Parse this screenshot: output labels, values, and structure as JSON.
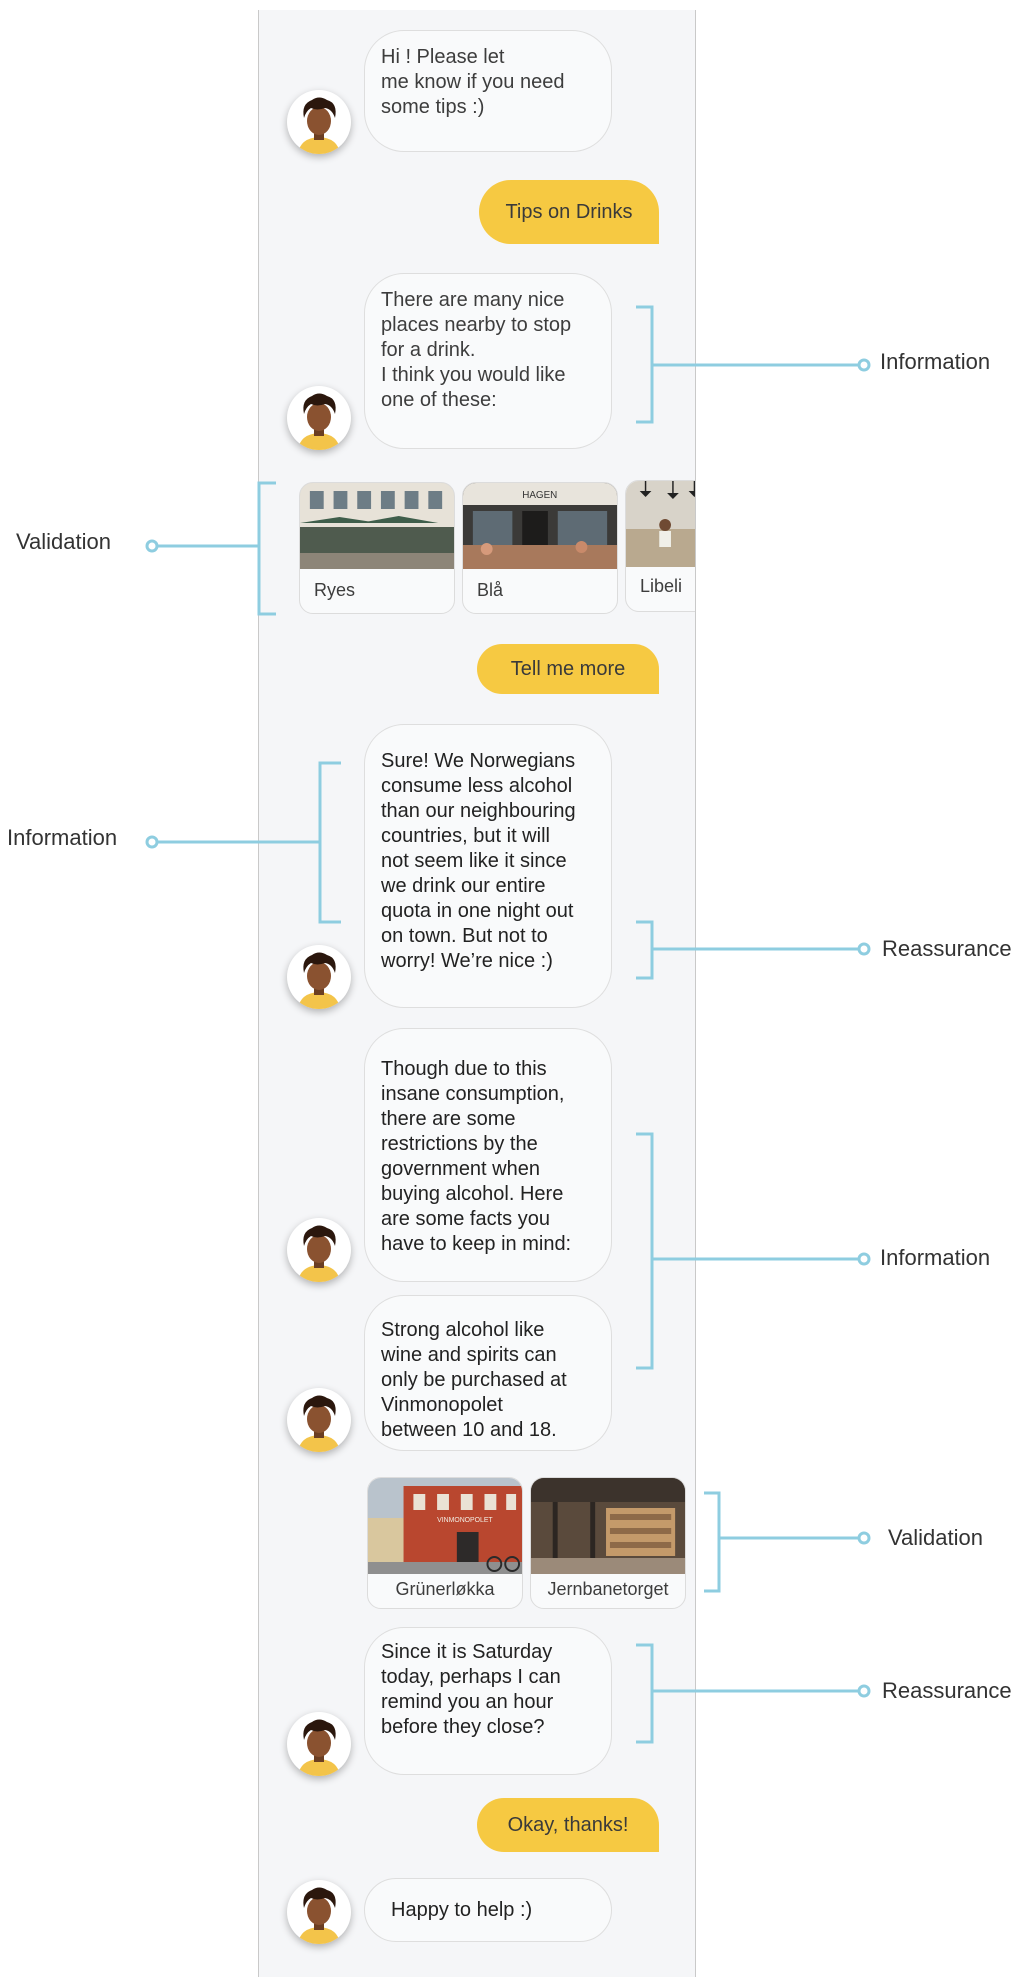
{
  "conversation": {
    "bot_greeting": [
      "Hi ! Please let",
      "me know if you need",
      "some tips :)"
    ],
    "user_tips": "Tips on Drinks",
    "bot_places": [
      "There are many nice",
      "places nearby to stop",
      "for a drink.",
      "I think you would like",
      "one of these:"
    ],
    "places": [
      {
        "name": "Ryes"
      },
      {
        "name": "Blå",
        "sign_text": "HAGEN"
      },
      {
        "name": "Libeli"
      }
    ],
    "user_more": "Tell me more",
    "bot_norwegians": [
      "Sure! We Norwegians",
      "consume less alcohol",
      "than our neighbouring",
      "countries, but it will",
      "not seem like it since",
      "we drink our entire",
      "quota in one night out",
      "on town. But not to",
      "worry! We’re nice :)"
    ],
    "bot_restrictions": [
      "Though due to this",
      "insane consumption,",
      "there are some",
      "restrictions by the",
      "government when",
      "buying alcohol. Here",
      "are some facts you",
      "have to keep in mind:"
    ],
    "bot_strong": [
      "Strong alcohol like",
      "wine and spirits can",
      "only be purchased at",
      "Vinmonopolet",
      "between 10 and 18."
    ],
    "stores": [
      {
        "name": "Grünerløkka",
        "sign_text": "VINMONOPOLET"
      },
      {
        "name": "Jernbanetorget"
      }
    ],
    "bot_saturday": [
      "Since it is Saturday",
      "today, perhaps I can",
      "remind you an hour",
      "before they close?"
    ],
    "user_thanks": "Okay, thanks!",
    "bot_happy": "Happy to help :)"
  },
  "annotations": {
    "info_1": "Information",
    "validation_1": "Validation",
    "info_2": "Information",
    "reassurance_1": "Reassurance",
    "info_3": "Information",
    "validation_2": "Validation",
    "reassurance_2": "Reassurance"
  },
  "colors": {
    "accent_yellow": "#f6c942",
    "annotation_blue": "#8ecde0",
    "panel_bg": "#f5f6f8",
    "bubble_bg": "#f9fafb"
  }
}
